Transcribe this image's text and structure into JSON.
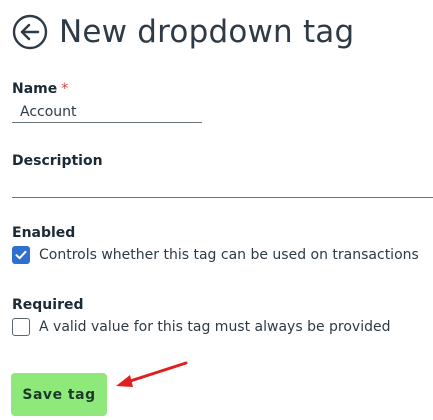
{
  "header": {
    "title": "New dropdown tag",
    "back_icon": "arrow-left-circle-icon"
  },
  "form": {
    "name": {
      "label": "Name",
      "required_marker": "*",
      "value": "Account"
    },
    "description": {
      "label": "Description",
      "value": ""
    },
    "enabled": {
      "label": "Enabled",
      "checked": true,
      "checkbox_text": "Controls whether this tag can be used on transactions"
    },
    "required": {
      "label": "Required",
      "checked": false,
      "checkbox_text": "A valid value for this tag must always be provided"
    }
  },
  "actions": {
    "save_label": "Save tag"
  },
  "colors": {
    "accent": "#2f6fd0",
    "save_button": "#8fe87a",
    "annotation_arrow": "#e02020",
    "required_star": "#d93b3b"
  }
}
